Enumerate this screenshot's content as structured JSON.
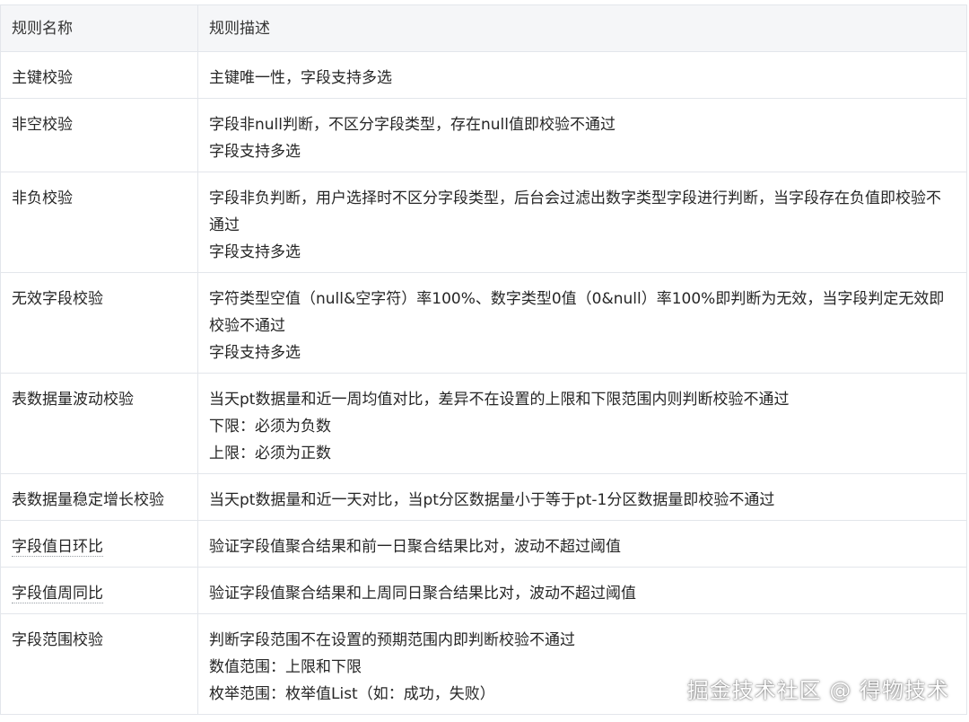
{
  "table": {
    "headers": [
      "规则名称",
      "规则描述"
    ],
    "rows": [
      {
        "name": "主键校验",
        "desc": [
          "主键唯一性，字段支持多选"
        ]
      },
      {
        "name": "非空校验",
        "desc": [
          "字段非null判断，不区分字段类型，存在null值即校验不通过",
          "字段支持多选"
        ]
      },
      {
        "name": "非负校验",
        "desc": [
          "字段非负判断，用户选择时不区分字段类型，后台会过滤出数字类型字段进行判断，当字段存在负值即校验不通过",
          "字段支持多选"
        ]
      },
      {
        "name": "无效字段校验",
        "desc": [
          "字符类型空值（null&空字符）率100%、数字类型0值（0&null）率100%即判断为无效，当字段判定无效即校验不通过",
          "字段支持多选"
        ]
      },
      {
        "name": "表数据量波动校验",
        "desc": [
          "当天pt数据量和近一周均值对比，差异不在设置的上限和下限范围内则判断校验不通过",
          "下限：必须为负数",
          "上限：必须为正数"
        ]
      },
      {
        "name": "表数据量稳定增长校验",
        "desc": [
          "当天pt数据量和近一天对比，当pt分区数据量小于等于pt-1分区数据量即校验不通过"
        ]
      },
      {
        "name": "字段值日环比",
        "desc": [
          "验证字段值聚合结果和前一日聚合结果比对，波动不超过阈值"
        ]
      },
      {
        "name": "字段值周同比",
        "desc": [
          "验证字段值聚合结果和上周同日聚合结果比对，波动不超过阈值"
        ]
      },
      {
        "name": "字段范围校验",
        "desc": [
          "判断字段范围不在设置的预期范围内即判断校验不通过",
          "数值范围：上限和下限",
          "枚举范围：枚举值List（如：成功，失败）"
        ]
      }
    ]
  },
  "watermark": "掘金技术社区 @ 得物技术"
}
